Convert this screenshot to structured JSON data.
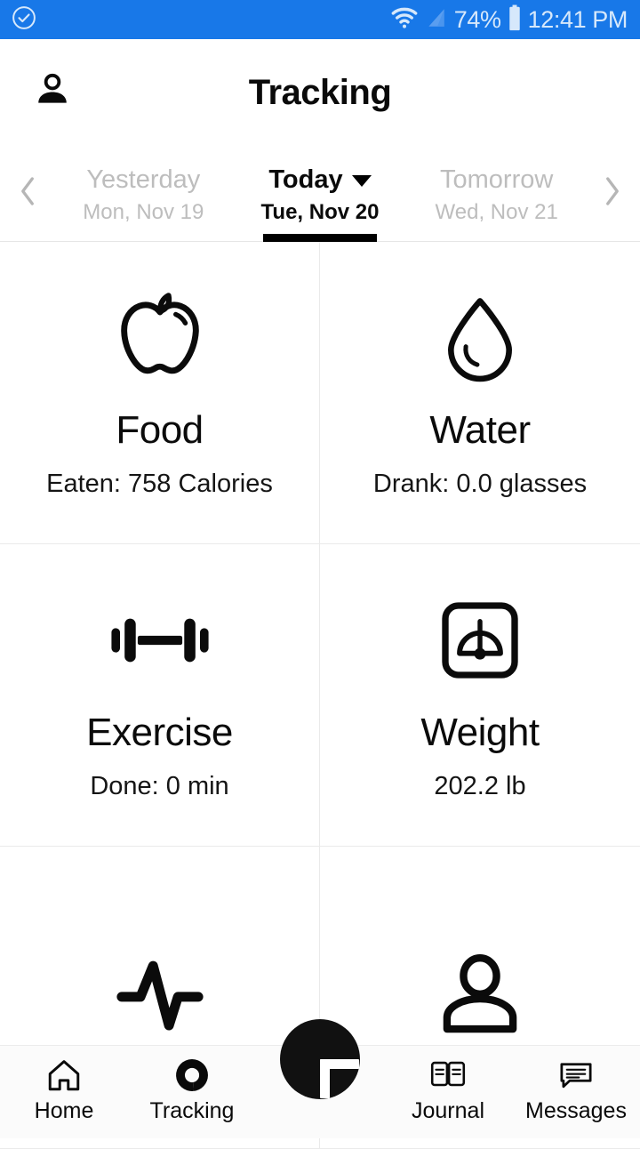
{
  "status_bar": {
    "background_color": "#1878E8",
    "text_color": "#D6E8FB",
    "left_icon": "check-circle-icon",
    "wifi_icon": "wifi-icon",
    "signal_icon": "cell-signal-icon",
    "battery_icon": "battery-icon",
    "battery_text": "74%",
    "time": "12:41 PM"
  },
  "header": {
    "title": "Tracking",
    "profile_icon": "person-icon"
  },
  "date_selector": {
    "prev_arrow_icon": "chevron-left-icon",
    "next_arrow_icon": "chevron-right-icon",
    "dropdown_icon": "caret-down-icon",
    "items": [
      {
        "label": "Yesterday",
        "sub": "Mon, Nov 19",
        "active": false
      },
      {
        "label": "Today",
        "sub": "Tue, Nov 20",
        "active": true
      },
      {
        "label": "Tomorrow",
        "sub": "Wed, Nov 21",
        "active": false
      }
    ]
  },
  "tiles": [
    {
      "title": "Food",
      "value": "Eaten: 758 Calories",
      "icon": "apple-icon"
    },
    {
      "title": "Water",
      "value": "Drank: 0.0 glasses",
      "icon": "water-drop-icon"
    },
    {
      "title": "Exercise",
      "value": "Done: 0 min",
      "icon": "dumbbell-icon"
    },
    {
      "title": "Weight",
      "value": "202.2 lb",
      "icon": "weight-scale-icon"
    },
    {
      "title": "",
      "value": "",
      "icon": "pulse-icon"
    },
    {
      "title": "",
      "value": "",
      "icon": "person-outline-icon"
    }
  ],
  "bottom_nav": {
    "items": [
      {
        "label": "Home",
        "icon": "home-icon"
      },
      {
        "label": "Tracking",
        "icon": "donut-chart-icon"
      },
      {
        "label": "Journal",
        "icon": "open-book-icon"
      },
      {
        "label": "Messages",
        "icon": "message-bubble-icon"
      }
    ],
    "fab": {
      "icon": "plus-icon",
      "color": "#111111"
    }
  },
  "colors": {
    "accent_blue": "#1878E8",
    "inactive_grey": "#BDBDBD",
    "divider": "#EAEAEA",
    "text": "#0A0A0A"
  }
}
